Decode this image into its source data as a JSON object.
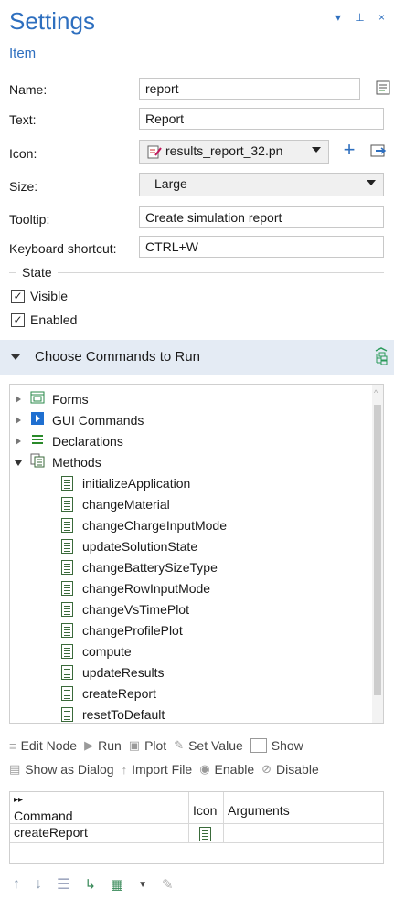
{
  "header": {
    "title": "Settings",
    "subtitle": "Item",
    "window_controls": "▾ ⊥ ×"
  },
  "form": {
    "name_label": "Name:",
    "name_value": "report",
    "text_label": "Text:",
    "text_value": "Report",
    "icon_label": "Icon:",
    "icon_value": "results_report_32.pn",
    "size_label": "Size:",
    "size_value": "Large",
    "tooltip_label": "Tooltip:",
    "tooltip_value": "Create simulation report",
    "shortcut_label": "Keyboard shortcut:",
    "shortcut_value": "CTRL+W"
  },
  "state": {
    "group_label": "State",
    "visible_label": "Visible",
    "visible_checked": true,
    "enabled_label": "Enabled",
    "enabled_checked": true
  },
  "commands_section": {
    "title": "Choose Commands to Run"
  },
  "tree": {
    "top_nodes": [
      {
        "label": "Forms",
        "icon": "forms-icon",
        "expanded": false
      },
      {
        "label": "GUI Commands",
        "icon": "gui-commands-icon",
        "expanded": false
      },
      {
        "label": "Declarations",
        "icon": "declarations-icon",
        "expanded": false
      },
      {
        "label": "Methods",
        "icon": "methods-icon",
        "expanded": true
      }
    ],
    "methods": [
      "initializeApplication",
      "changeMaterial",
      "changeChargeInputMode",
      "updateSolutionState",
      "changeBatterySizeType",
      "changeRowInputMode",
      "changeVsTimePlot",
      "changeProfilePlot",
      "compute",
      "updateResults",
      "createReport",
      "resetToDefault"
    ]
  },
  "toolbar": {
    "edit_node": "Edit Node",
    "run": "Run",
    "plot": "Plot",
    "set_value": "Set Value",
    "show": "Show",
    "show_as_dialog": "Show as Dialog",
    "import_file": "Import File",
    "enable": "Enable",
    "disable": "Disable"
  },
  "table": {
    "headers": {
      "command": "Command",
      "icon": "Icon",
      "arguments": "Arguments"
    },
    "rows": [
      {
        "command": "createReport",
        "icon": "method-icon",
        "arguments": ""
      }
    ]
  },
  "bottom_tools": [
    "move-up-icon",
    "move-down-icon",
    "delete-icon",
    "add-icon",
    "add-below-icon",
    "dropdown-icon",
    "edit-icon"
  ]
}
